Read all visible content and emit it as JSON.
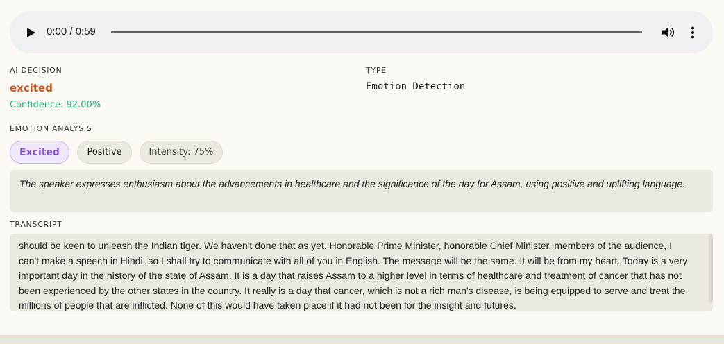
{
  "player": {
    "time": "0:00 / 0:59",
    "progress": 0,
    "icons": [
      "play-icon",
      "volume-icon",
      "more-vertical-icon"
    ]
  },
  "decision": {
    "label": "AI DECISION",
    "value": "excited",
    "confidence": "Confidence: 92.00%"
  },
  "type": {
    "label": "TYPE",
    "value": "Emotion Detection"
  },
  "emotion": {
    "label": "EMOTION ANALYSIS",
    "chips": [
      "Excited",
      "Positive",
      "Intensity: 75%"
    ],
    "summary": "The speaker expresses enthusiasm about the advancements in healthcare and the significance of the day for Assam, using positive and uplifting language."
  },
  "transcript": {
    "label": "TRANSCRIPT",
    "text": "should be keen to unleash the Indian tiger. We haven't done that as yet. Honorable Prime Minister, honorable Chief Minister, members of the audience, I can't make a speech in Hindi, so I shall try to communicate with all of you in English. The message will be the same. It will be from my heart. Today is a very important day in the history of the state of Assam. It is a day that raises Assam to a higher level in terms of healthcare and treatment of cancer that has not been experienced by the other states in the country. It really is a day that cancer, which is not a rich man's disease, is being equipped to serve and treat the millions of people that are inflicted. None of this would have taken place if it had not been for the insight and futures."
  },
  "colors": {
    "decision": "#c2541b",
    "confidence": "#1db382",
    "excited_chip": "#8a55d8"
  }
}
